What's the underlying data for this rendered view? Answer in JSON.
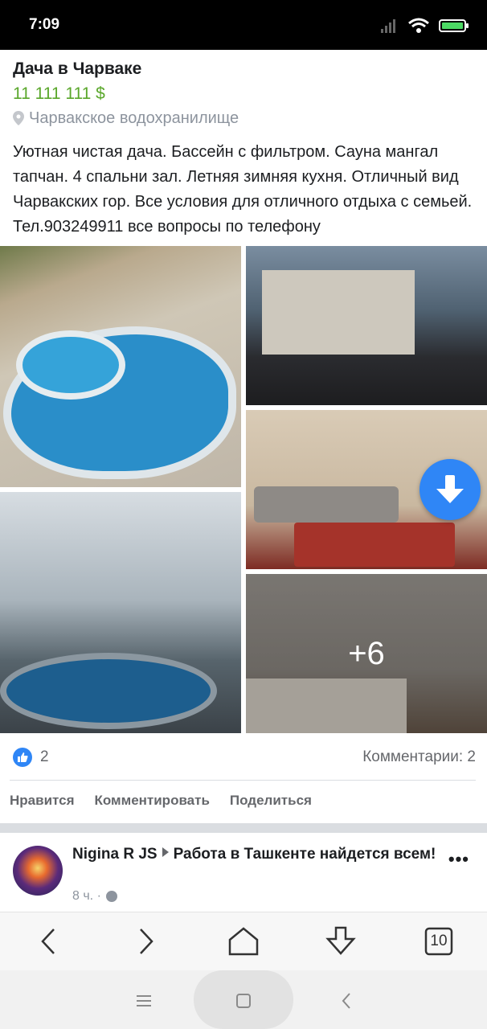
{
  "status_bar": {
    "time": "7:09"
  },
  "post": {
    "title": "Дача в Чарваке",
    "price": "11 111 111 $",
    "location": "Чарвакское водохранилище",
    "text": "Уютная чистая дача. Бассейн с фильтром. Сауна мангал тапчан. 4 спальни зал. Летняя зимняя кухня. Отличный вид Чарвакских гор. Все условия для отличного отдыха с семьей. Тел.903249911 все вопросы по телефону",
    "more_photos": "+6",
    "likes": "2",
    "comments": "Комментарии: 2",
    "actions": {
      "like": "Нравится",
      "comment": "Комментировать",
      "share": "Поделиться"
    }
  },
  "next_post": {
    "author": "Nigina R JS",
    "group": "Работа в Ташкенте найдется всем!",
    "time": "8 ч. ·"
  },
  "browser_bar": {
    "tabs_count": "10"
  },
  "colors": {
    "price": "#5aa72b",
    "accent": "#2f86f6"
  }
}
